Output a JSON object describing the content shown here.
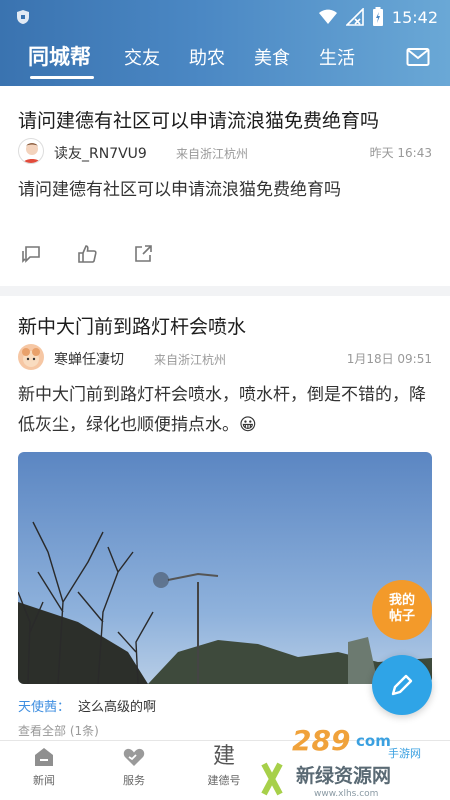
{
  "status": {
    "time": "15:42"
  },
  "tabs": [
    {
      "label": "同城帮",
      "active": true
    },
    {
      "label": "交友"
    },
    {
      "label": "助农"
    },
    {
      "label": "美食"
    },
    {
      "label": "生活"
    }
  ],
  "posts": [
    {
      "title": "请问建德有社区可以申请流浪猫免费绝育吗",
      "author": "读友_RN7VU9",
      "location": "来自浙江杭州",
      "time": "昨天 16:43",
      "body": "请问建德有社区可以申请流浪猫免费绝育吗"
    },
    {
      "title": "新中大门前到路灯杆会喷水",
      "author": "寒蝉任凄切",
      "location": "来自浙江杭州",
      "time": "1月18日 09:51",
      "body": "新中大门前到路灯杆会喷水，喷水杆，倒是不错的，降低灰尘，绿化也顺便掯点水。😀",
      "comment": {
        "name": "天使茜：",
        "text": "这么高级的啊"
      },
      "view_all": "查看全部 (1条)"
    }
  ],
  "floating": {
    "my_posts_line1": "我的",
    "my_posts_line2": "帖子"
  },
  "nav": [
    {
      "label": "新闻"
    },
    {
      "label": "服务"
    },
    {
      "label": "建德号",
      "glyph": "建"
    },
    {
      "label": ""
    },
    {
      "label": ""
    }
  ],
  "watermark": {
    "brand": "289",
    "suffix": "com",
    "tag": "手游网",
    "site": "新绿资源网",
    "url": "www.xlhs.com"
  },
  "colors": {
    "header_start": "#3a73b0",
    "header_end": "#6aa8d6",
    "accent": "#2fa4e7",
    "my_posts": "#f39a2a",
    "comment_name": "#3e8ee0"
  },
  "icons": [
    "shield-icon",
    "wifi-icon",
    "signal-icon",
    "battery-icon",
    "mail-icon",
    "comment-icon",
    "like-icon",
    "share-icon",
    "pencil-icon",
    "news-icon",
    "heart-icon"
  ]
}
